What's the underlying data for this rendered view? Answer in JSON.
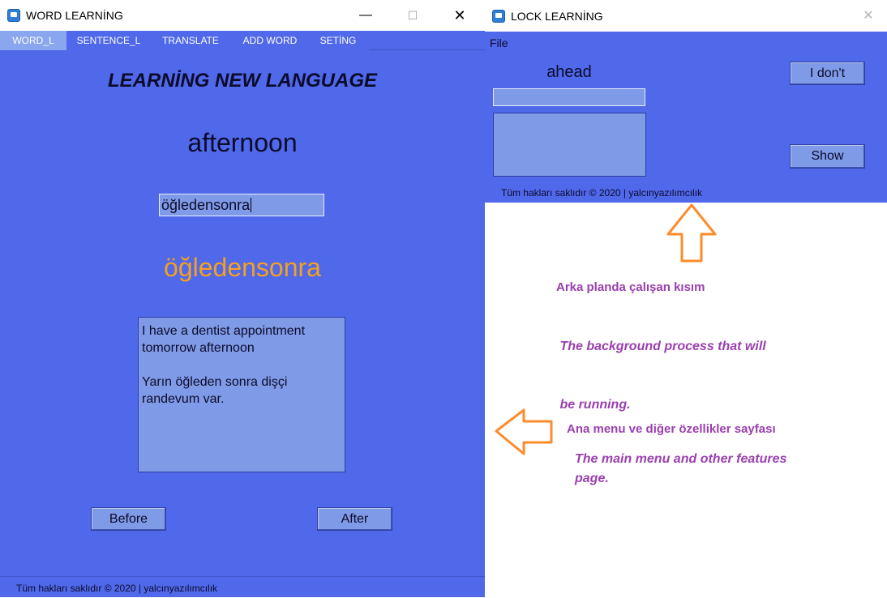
{
  "word_window": {
    "title": "WORD LEARNİNG",
    "controls": {
      "minimize": "—",
      "maximize": "☐",
      "close": "✕"
    },
    "tabs": [
      {
        "label": "WORD_L",
        "active": true
      },
      {
        "label": "SENTENCE_L",
        "active": false
      },
      {
        "label": "TRANSLATE",
        "active": false
      },
      {
        "label": "ADD WORD",
        "active": false
      },
      {
        "label": "SETİNG",
        "active": false
      }
    ],
    "heading": "LEARNİNG NEW LANGUAGE",
    "word": "afternoon",
    "answer_value": "öğledensonra",
    "translation": "öğledensonra",
    "example_lines": [
      " I have a dentist appointment",
      "tomorrow afternoon",
      "",
      " Yarın öğleden sonra dişçi",
      "randevum var."
    ],
    "buttons": {
      "before": "Before",
      "after": "After"
    },
    "footer": "Tüm hakları saklıdır © 2020  |  yalcınyazılımcılık"
  },
  "lock_window": {
    "title": "LOCK LEARNİNG",
    "controls": {
      "close": "✕"
    },
    "menu": {
      "file": "File"
    },
    "word": "ahead",
    "answer_value": "",
    "buttons": {
      "dont_know": "I don't",
      "show": "Show"
    },
    "footer": "Tüm hakları saklıdır © 2020  |  yalcınyazılımcılık"
  },
  "annotations": {
    "background_tr": "Arka planda çalışan kısım",
    "background_en_lines": [
      " The background process that will",
      " be running."
    ],
    "main_tr": "Ana menu ve diğer özellikler sayfası",
    "main_en_lines": [
      "The main menu and other features",
      "page."
    ]
  },
  "colors": {
    "window_bg": "#5068ea",
    "field_bg": "#7f9ae6",
    "translation_text": "#f4a020",
    "annotation_text": "#9a3fae",
    "arrow_stroke": "#ff8a2a"
  },
  "icons": {
    "app": "app-icon",
    "up_arrow": "up-arrow-icon",
    "left_arrow": "left-arrow-icon"
  }
}
